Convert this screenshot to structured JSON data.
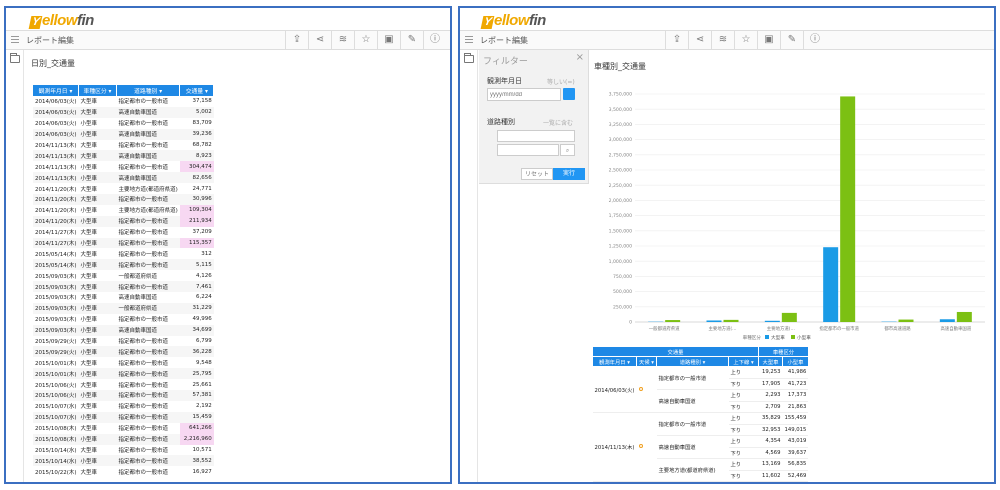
{
  "logo": {
    "y": "Y",
    "ellow": "ellow",
    "fin": "fin"
  },
  "toolbar": {
    "tab_report": "レポート",
    "tab_edit": "編集",
    "icons": [
      "export-icon",
      "share-icon",
      "rss-icon",
      "star-icon",
      "bookmark-icon",
      "pin-icon",
      "info-icon"
    ]
  },
  "left": {
    "title": "日別_交通量",
    "columns": [
      "観測年月日",
      "車種区分",
      "道路種別",
      "交通量"
    ],
    "rows": [
      [
        "2014/06/03(火)",
        "大型車",
        "指定都市の一般市道",
        "37,158",
        false
      ],
      [
        "2014/06/03(火)",
        "大型車",
        "高速自動車国道",
        "5,002",
        false
      ],
      [
        "2014/06/03(火)",
        "小型車",
        "指定都市の一般市道",
        "83,709",
        false
      ],
      [
        "2014/06/03(火)",
        "小型車",
        "高速自動車国道",
        "39,236",
        false
      ],
      [
        "2014/11/13(木)",
        "大型車",
        "指定都市の一般市道",
        "68,782",
        false
      ],
      [
        "2014/11/13(木)",
        "大型車",
        "高速自動車国道",
        "8,923",
        false
      ],
      [
        "2014/11/13(木)",
        "小型車",
        "指定都市の一般市道",
        "304,474",
        true
      ],
      [
        "2014/11/13(木)",
        "小型車",
        "高速自動車国道",
        "82,656",
        false
      ],
      [
        "2014/11/20(木)",
        "大型車",
        "主要地方道(都道府県道)",
        "24,771",
        false
      ],
      [
        "2014/11/20(木)",
        "大型車",
        "指定都市の一般市道",
        "30,996",
        false
      ],
      [
        "2014/11/20(木)",
        "小型車",
        "主要地方道(都道府県道)",
        "109,304",
        true
      ],
      [
        "2014/11/20(木)",
        "小型車",
        "指定都市の一般市道",
        "211,934",
        true
      ],
      [
        "2014/11/27(木)",
        "大型車",
        "指定都市の一般市道",
        "37,209",
        false
      ],
      [
        "2014/11/27(木)",
        "小型車",
        "指定都市の一般市道",
        "115,357",
        true
      ],
      [
        "2015/05/14(木)",
        "大型車",
        "指定都市の一般市道",
        "312",
        false
      ],
      [
        "2015/05/14(木)",
        "小型車",
        "指定都市の一般市道",
        "5,115",
        false
      ],
      [
        "2015/09/03(木)",
        "大型車",
        "一般都道府県道",
        "4,126",
        false
      ],
      [
        "2015/09/03(木)",
        "大型車",
        "指定都市の一般市道",
        "7,461",
        false
      ],
      [
        "2015/09/03(木)",
        "大型車",
        "高速自動車国道",
        "6,224",
        false
      ],
      [
        "2015/09/03(木)",
        "小型車",
        "一般都道府県道",
        "31,229",
        false
      ],
      [
        "2015/09/03(木)",
        "小型車",
        "指定都市の一般市道",
        "49,996",
        false
      ],
      [
        "2015/09/03(木)",
        "小型車",
        "高速自動車国道",
        "34,699",
        false
      ],
      [
        "2015/09/29(火)",
        "大型車",
        "指定都市の一般市道",
        "6,799",
        false
      ],
      [
        "2015/09/29(火)",
        "小型車",
        "指定都市の一般市道",
        "36,228",
        false
      ],
      [
        "2015/10/01(木)",
        "大型車",
        "指定都市の一般市道",
        "9,548",
        false
      ],
      [
        "2015/10/01(木)",
        "小型車",
        "指定都市の一般市道",
        "25,795",
        false
      ],
      [
        "2015/10/06(火)",
        "大型車",
        "指定都市の一般市道",
        "25,661",
        false
      ],
      [
        "2015/10/06(火)",
        "小型車",
        "指定都市の一般市道",
        "57,381",
        false
      ],
      [
        "2015/10/07(水)",
        "大型車",
        "指定都市の一般市道",
        "2,192",
        false
      ],
      [
        "2015/10/07(水)",
        "小型車",
        "指定都市の一般市道",
        "15,459",
        false
      ],
      [
        "2015/10/08(木)",
        "大型車",
        "指定都市の一般市道",
        "641,266",
        true
      ],
      [
        "2015/10/08(木)",
        "小型車",
        "指定都市の一般市道",
        "2,216,960",
        true
      ],
      [
        "2015/10/14(水)",
        "大型車",
        "指定都市の一般市道",
        "10,571",
        false
      ],
      [
        "2015/10/14(水)",
        "小型車",
        "指定都市の一般市道",
        "38,552",
        false
      ],
      [
        "2015/10/22(木)",
        "大型車",
        "指定都市の一般市道",
        "16,927",
        false
      ]
    ]
  },
  "filter": {
    "title": "フィルター",
    "close": "×",
    "date_label": "観測年月日",
    "date_hint": "等しい(=)",
    "date_placeholder": "yyyy/mm/dd",
    "road_label": "道路種別",
    "road_hint": "一覧に含む",
    "reset": "リセット",
    "run": "実行"
  },
  "right": {
    "title": "車種別_交通量"
  },
  "chart_data": {
    "type": "bar",
    "categories": [
      "一般都道府県道",
      "主要地方道(…",
      "主要地方道(…",
      "指定都市の一般市道",
      "都市高速道路",
      "高速自動車国道"
    ],
    "series": [
      {
        "name": "大型車",
        "color": "#1a9be6",
        "values": [
          5000,
          25000,
          20000,
          1230000,
          6000,
          45000
        ]
      },
      {
        "name": "小型車",
        "color": "#7cc013",
        "values": [
          32000,
          35000,
          150000,
          3710000,
          40000,
          165000
        ]
      }
    ],
    "ylim": [
      0,
      3750000
    ],
    "yticks": [
      "0",
      "250,000",
      "500,000",
      "750,000",
      "1,000,000",
      "1,250,000",
      "1,500,000",
      "1,750,000",
      "2,000,000",
      "2,250,000",
      "2,500,000",
      "2,750,000",
      "3,000,000",
      "3,250,000",
      "3,500,000",
      "3,750,000"
    ],
    "legend_title": "車種区分",
    "grid": true,
    "legend": "bottom"
  },
  "rtable": {
    "hdr_traffic": "交通量",
    "hdr_type": "車種区分",
    "col_date": "観測年月日",
    "col_weather": "天候",
    "col_road": "道路種別",
    "col_dir": "上下線",
    "col_large": "大型車",
    "col_small": "小型車",
    "date1": "2014/06/03(火)",
    "date2": "2014/11/13(木)",
    "road_a": "指定都市の一般市道",
    "road_b": "高速自動車国道",
    "road_c": "主要地方道(都道府県道)",
    "up": "上り",
    "down": "下り",
    "r1": [
      "19,253",
      "41,986"
    ],
    "r2": [
      "17,905",
      "41,723"
    ],
    "r3": [
      "2,293",
      "17,373"
    ],
    "r4": [
      "2,709",
      "21,863"
    ],
    "r5": [
      "35,829",
      "155,459"
    ],
    "r6": [
      "32,953",
      "149,015"
    ],
    "r7": [
      "4,354",
      "43,019"
    ],
    "r8": [
      "4,569",
      "39,637"
    ],
    "r9": [
      "13,169",
      "56,835"
    ],
    "r10": [
      "11,602",
      "52,469"
    ]
  }
}
